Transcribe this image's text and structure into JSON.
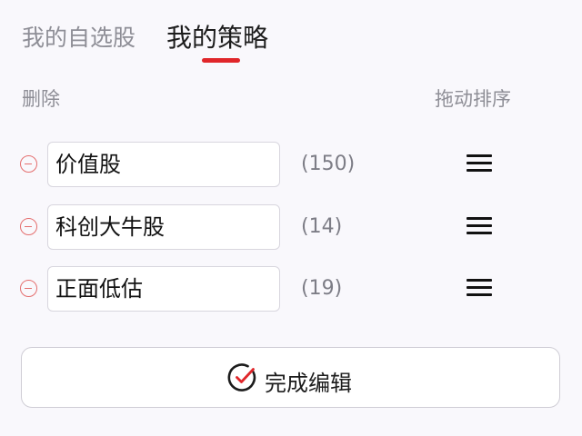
{
  "tabs": {
    "items": [
      {
        "label": "我的自选股",
        "active": false
      },
      {
        "label": "我的策略",
        "active": true
      }
    ],
    "accent_color": "#e0262a"
  },
  "columns": {
    "delete_label": "删除",
    "sort_label": "拖动排序"
  },
  "strategies": [
    {
      "name": "价值股",
      "count": "(150)"
    },
    {
      "name": "科创大牛股",
      "count": "(14)"
    },
    {
      "name": "正面低估",
      "count": "(19)"
    }
  ],
  "footer": {
    "done_label": "完成编辑",
    "done_icon": "check-circle-icon"
  },
  "colors": {
    "remove_icon": "#e46e6e",
    "check_mark": "#e0262a"
  }
}
